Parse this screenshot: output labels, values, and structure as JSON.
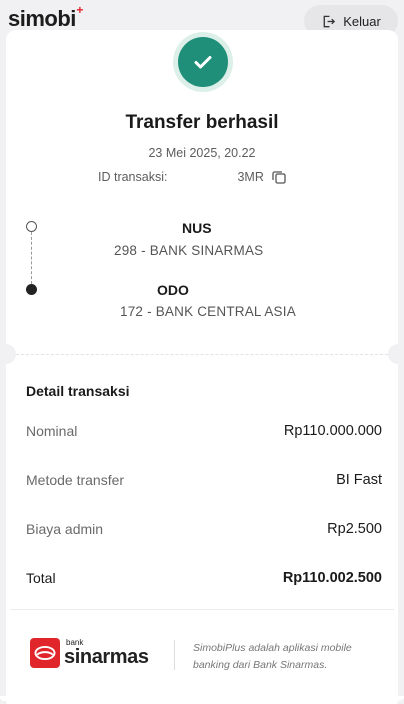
{
  "app": {
    "brand": "simobi",
    "brand_plus": "+",
    "logout_label": "Keluar"
  },
  "result": {
    "title": "Transfer berhasil",
    "datetime": "23 Mei 2025, 20.22",
    "transaction_id_label": "ID transaksi:",
    "transaction_id_suffix": "3MR"
  },
  "sender": {
    "name": "NUS",
    "bank": "298 - BANK SINARMAS"
  },
  "receiver": {
    "name": "ODO",
    "bank": "172 - BANK CENTRAL ASIA"
  },
  "details": {
    "title": "Detail transaksi",
    "rows": [
      {
        "label": "Nominal",
        "value": "Rp110.000.000"
      },
      {
        "label": "Metode transfer",
        "value": "BI Fast"
      },
      {
        "label": "Biaya admin",
        "value": "Rp2.500"
      }
    ],
    "total": {
      "label": "Total",
      "value": "Rp110.002.500"
    }
  },
  "footer": {
    "bank_small": "bank",
    "bank_big": "sinarmas",
    "tagline": "SimobiPlus adalah aplikasi mobile banking dari Bank Sinarmas."
  },
  "colors": {
    "success": "#1f8f79",
    "brand_red": "#e0252b"
  }
}
